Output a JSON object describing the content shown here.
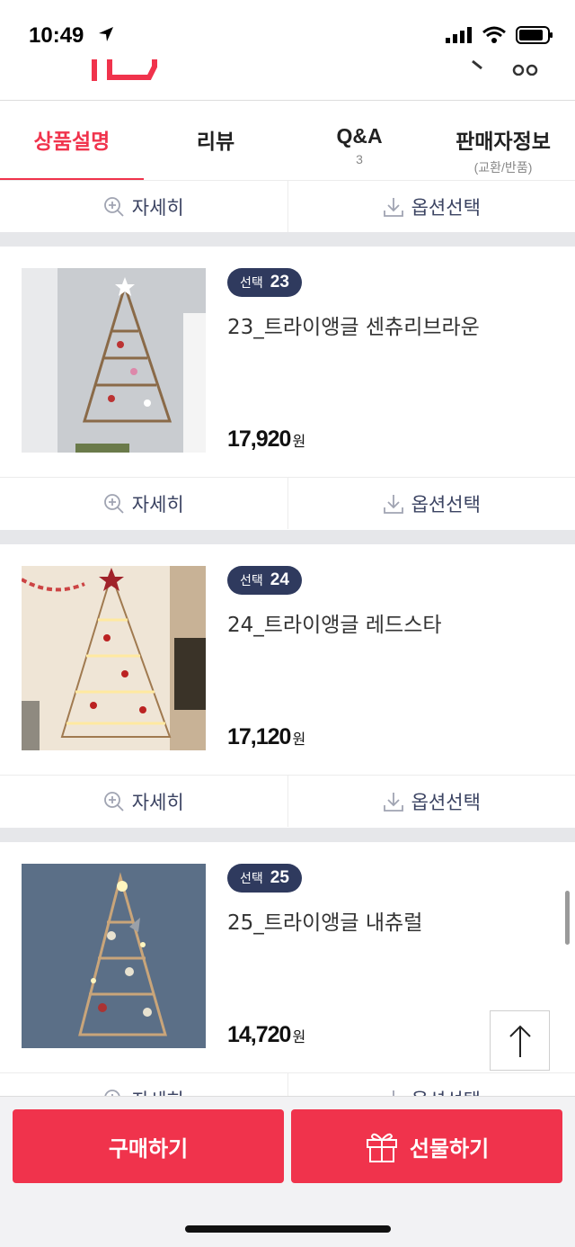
{
  "status": {
    "time": "10:49"
  },
  "tabs": [
    {
      "label": "상품설명",
      "sub": ""
    },
    {
      "label": "리뷰",
      "sub": ""
    },
    {
      "label": "Q&A",
      "sub": "3"
    },
    {
      "label": "판매자정보",
      "sub": "(교환/반품)"
    }
  ],
  "actions": {
    "detail": "자세히",
    "option": "옵션선택"
  },
  "products": [
    {
      "badge_label": "선택",
      "badge_num": "23",
      "name": "23_트라이앵글 센츄리브라운",
      "price": "17,920",
      "unit": "원"
    },
    {
      "badge_label": "선택",
      "badge_num": "24",
      "name": "24_트라이앵글 레드스타",
      "price": "17,120",
      "unit": "원"
    },
    {
      "badge_label": "선택",
      "badge_num": "25",
      "name": "25_트라이앵글 내츄럴",
      "price": "14,720",
      "unit": "원"
    }
  ],
  "bottom": {
    "buy": "구매하기",
    "gift": "선물하기"
  },
  "colors": {
    "accent": "#f0334c",
    "badge": "#2f3a5e"
  }
}
